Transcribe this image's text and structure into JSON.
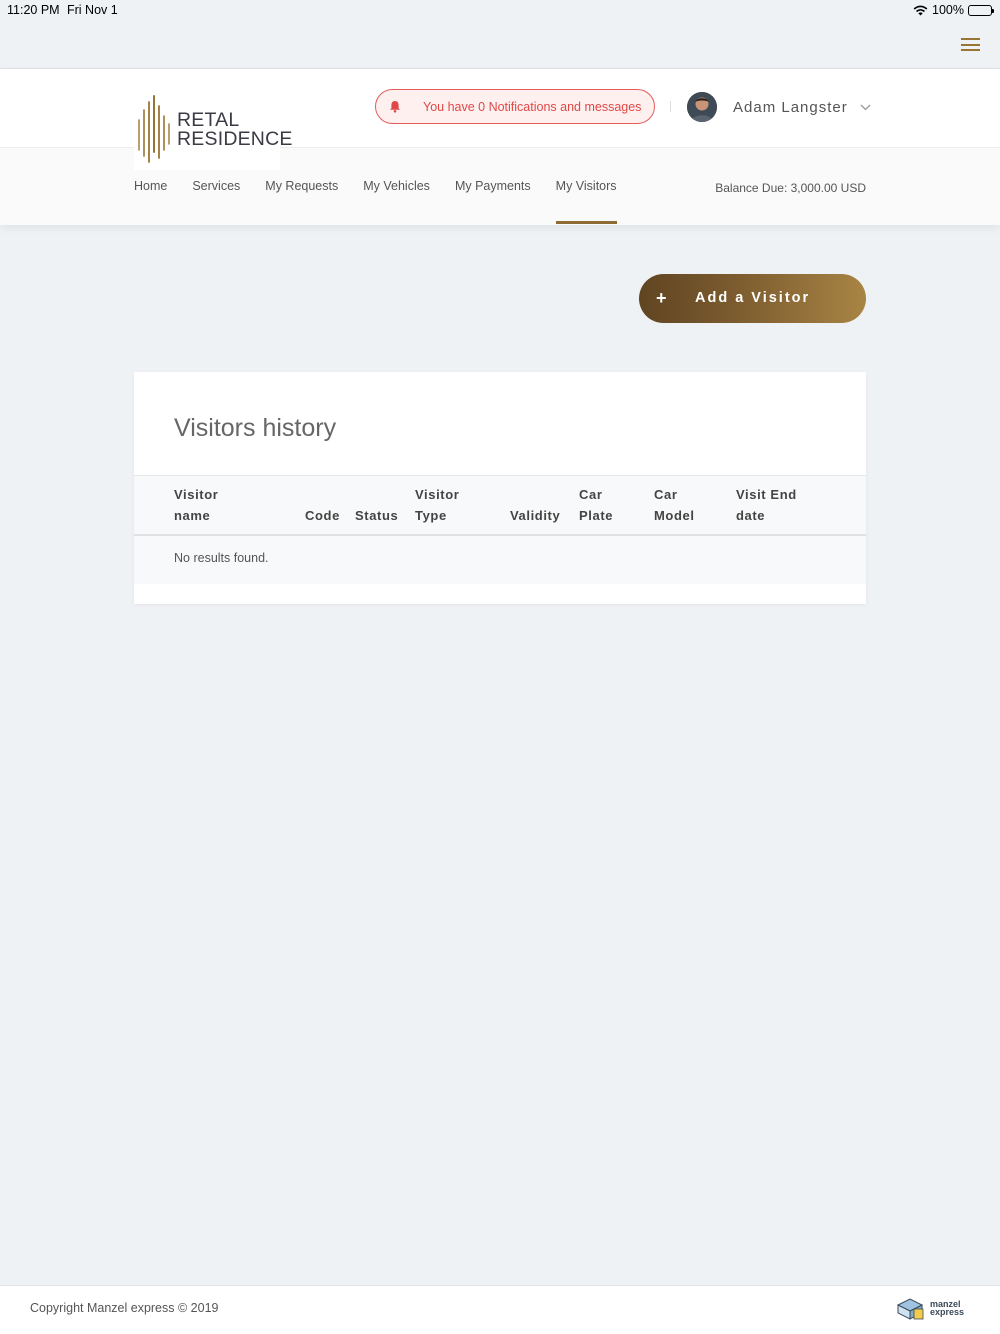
{
  "status_bar": {
    "time": "11:20 PM",
    "date": "Fri Nov 1",
    "battery": "100%"
  },
  "brand": {
    "logo_line1": "RETAL",
    "logo_line2": "RESIDENCE",
    "accent_color": "#8f6b34"
  },
  "header": {
    "notification_text": "You have 0 Notifications and messages",
    "user_name": "Adam Langster",
    "balance": "Balance Due: 3,000.00 USD"
  },
  "nav": {
    "items": [
      "Home",
      "Services",
      "My Requests",
      "My Vehicles",
      "My Payments",
      "My Visitors"
    ],
    "active": "My Visitors"
  },
  "actions": {
    "add_visitor": "Add a Visitor"
  },
  "visitors_card": {
    "title": "Visitors history",
    "columns": [
      [
        "Visitor",
        "name"
      ],
      [
        "Code"
      ],
      [
        "Status"
      ],
      [
        "Visitor",
        "Type"
      ],
      [
        "Validity"
      ],
      [
        "Car",
        "Plate"
      ],
      [
        "Car",
        "Model"
      ],
      [
        "Visit End",
        "date"
      ]
    ],
    "empty_message": "No results found."
  },
  "footer": {
    "copyright": "Copyright Manzel express © 2019",
    "logo_line1": "manzel",
    "logo_line2": "express"
  }
}
